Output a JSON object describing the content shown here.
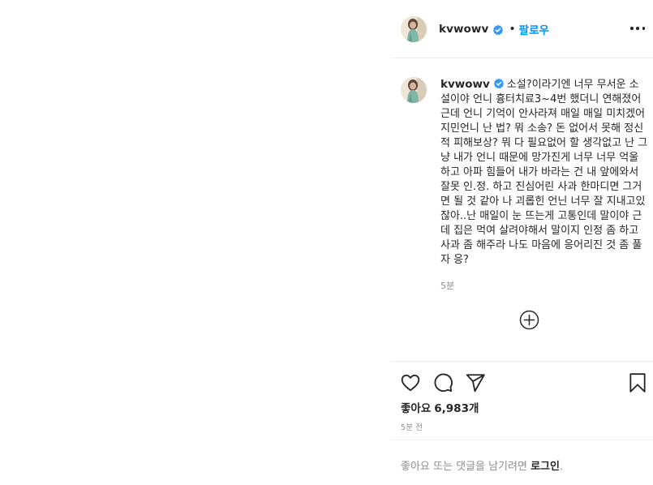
{
  "post": {
    "username": "kvwowv",
    "follow_label": "팔로우",
    "separator": "•",
    "caption_username": "kvwowv",
    "caption_text": "소설?이라기엔 너무 무서운 소설이야 언니 흉터치료3~4번 했더니 연해졌어 근데 언니 기억이 안사라져 매일 매일 미치겠어 지민언니 난 법? 뭐 소송? 돈 없어서 못해 정신적 피해보상? 뭐 다 필요없어 할 생각없고 난 그냥 내가 언니 때문에 망가진게 너무 너무 억울하고 아파 힘들어 내가 바라는 건 내 앞에와서 잘못 인.정. 하고 진심어린 사과 한마디면 그거면 될 것 같아 나 괴롭힌 언닌 너무 잘 지내고있잖아..난 매일이 눈 뜨는게 고통인데 말이야 근데 집은 먹여 살려야해서 말이지 인정 좀 하고 사과 좀 해주라 나도 마음에 응어리진 것 좀 풀자 응?",
    "caption_time": "5분",
    "likes_label": "좋아요",
    "likes_count": "6,983개",
    "post_date": "5분 전",
    "login_prompt": "좋아요 또는 댓글을 남기려면 ",
    "login_link": "로그인",
    "login_suffix": "."
  },
  "icons": {
    "verified": "verified-badge-icon",
    "more": "more-options-icon",
    "load_more": "plus-circle-icon",
    "like": "heart-icon",
    "comment": "comment-icon",
    "share": "paper-plane-icon",
    "save": "bookmark-icon"
  },
  "colors": {
    "accent": "#0095f6",
    "text": "#262626",
    "secondary": "#8e8e8e",
    "divider": "#efefef"
  }
}
